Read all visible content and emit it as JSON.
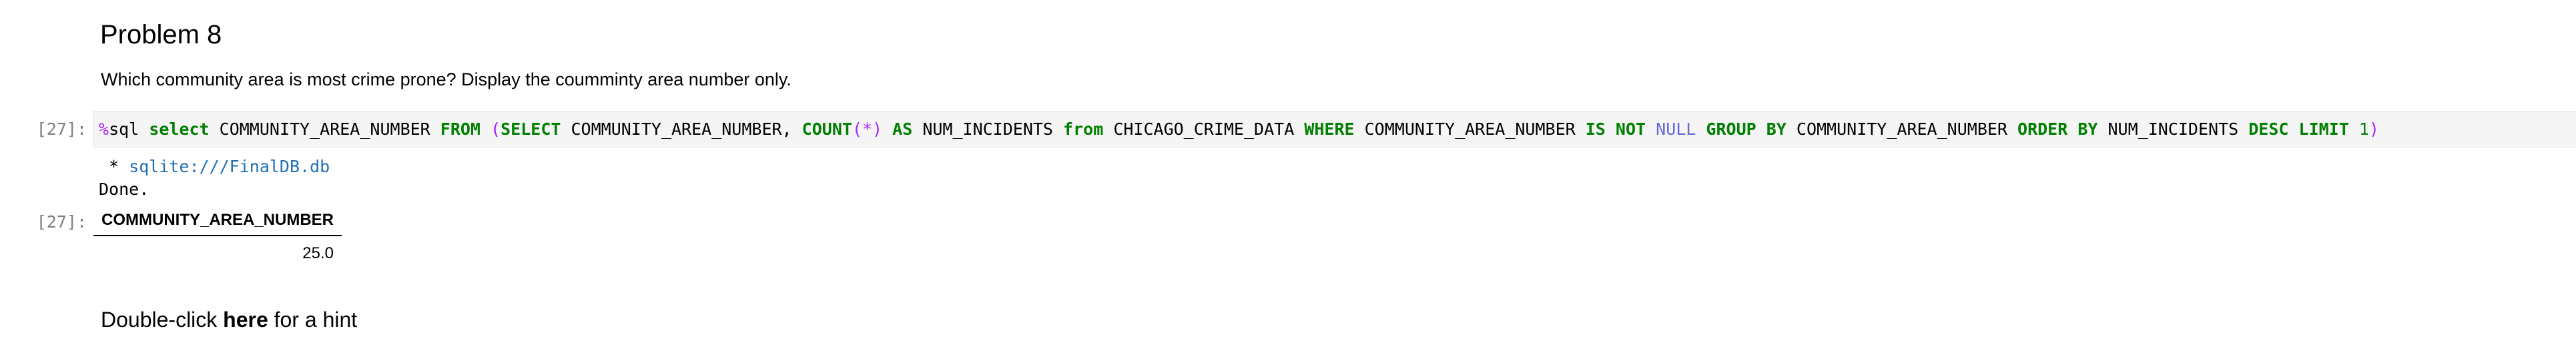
{
  "markdown_cell": {
    "heading": "Problem 8",
    "question": "Which community area is most crime prone? Display the coumminty area number only."
  },
  "code_cell": {
    "input_prompt": "[27]:",
    "tokens": {
      "magic_pct": "%",
      "magic_sql": "sql ",
      "kw_select": "select",
      "col_1": " COMMUNITY_AREA_NUMBER ",
      "kw_from_upper": "FROM",
      "sp_1": " ",
      "paren_open": "(",
      "kw_select_upper": "SELECT",
      "col_2": " COMMUNITY_AREA_NUMBER, ",
      "kw_count": "COUNT",
      "count_args": "(*)",
      "sp_2": " ",
      "kw_as": "AS",
      "alias_1": " NUM_INCIDENTS ",
      "kw_from_lower": "from",
      "table_name": " CHICAGO_CRIME_DATA ",
      "kw_where": "WHERE",
      "col_3": " COMMUNITY_AREA_NUMBER ",
      "kw_is": "IS",
      "sp_3": " ",
      "kw_not": "NOT",
      "sp_4": " ",
      "null_kw": "NULL",
      "sp_5": " ",
      "kw_group_by": "GROUP BY",
      "col_4": " COMMUNITY_AREA_NUMBER ",
      "kw_order_by": "ORDER BY",
      "alias_2": " NUM_INCIDENTS ",
      "kw_desc": "DESC",
      "sp_6": " ",
      "kw_limit": "LIMIT",
      "sp_7": " ",
      "num_limit": "1",
      "paren_close": ")"
    }
  },
  "stream_output": {
    "db_bullet": " * ",
    "db_url": "sqlite:///FinalDB.db",
    "done": "Done."
  },
  "result_output": {
    "output_prompt": "[27]:",
    "columns": [
      "COMMUNITY_AREA_NUMBER"
    ],
    "rows": [
      [
        "25.0"
      ]
    ]
  },
  "hint_cell": {
    "prefix": "Double-click ",
    "link_word": "here",
    "suffix": " for a hint"
  }
}
